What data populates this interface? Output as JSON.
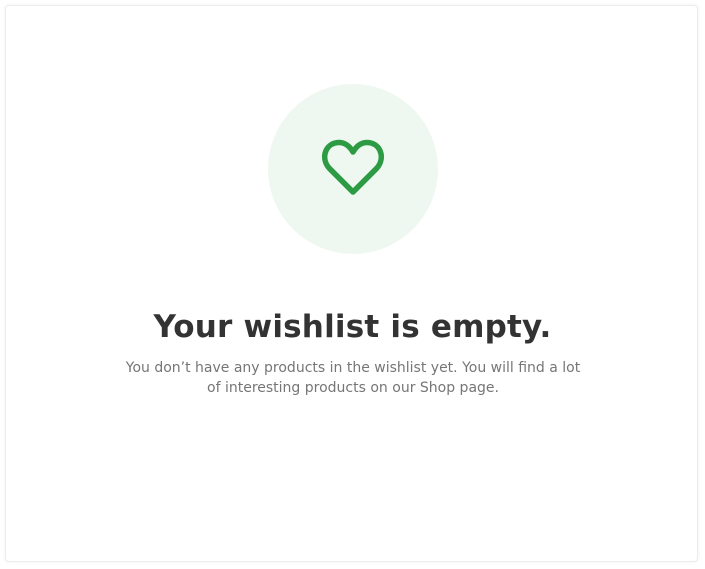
{
  "empty_state": {
    "icon": "heart-icon",
    "title": "Your wishlist is empty.",
    "description": "You don’t have any products in the wishlist yet. You will find a lot of interesting products on our Shop page."
  },
  "colors": {
    "accent": "#2d9b44",
    "icon_background": "#eff7f1",
    "title": "#333333",
    "text": "#767676"
  }
}
